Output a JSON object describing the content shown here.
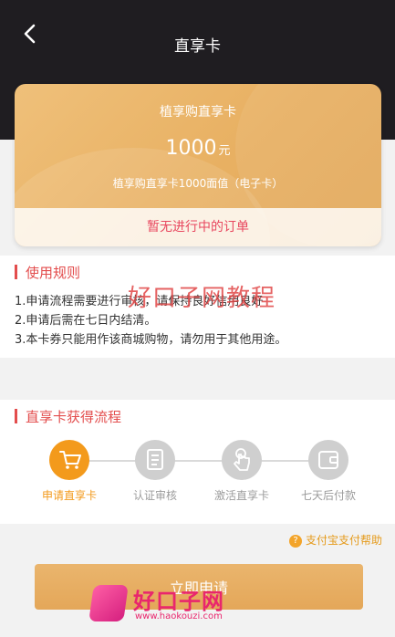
{
  "header": {
    "title": "直享卡"
  },
  "card": {
    "name": "植享购直享卡",
    "amount": "1000",
    "unit": "元",
    "description": "植享购直享卡1000面值（电子卡）",
    "order_status": "暂无进行中的订单"
  },
  "watermark": "好口子网教程",
  "rules": {
    "title": "使用规则",
    "items": [
      "1.申请流程需要进行审核，请保持良好信用良好",
      "2.申请后需在七日内结清。",
      "3.本卡券只能用作该商城购物，请勿用于其他用途。"
    ]
  },
  "flow": {
    "title": "直享卡获得流程",
    "steps": [
      {
        "label": "申请直享卡",
        "icon": "cart-icon",
        "active": true
      },
      {
        "label": "认证审核",
        "icon": "document-icon",
        "active": false
      },
      {
        "label": "激活直享卡",
        "icon": "hand-touch-icon",
        "active": false
      },
      {
        "label": "七天后付款",
        "icon": "wallet-icon",
        "active": false
      }
    ]
  },
  "help": {
    "label": "支付宝支付帮助"
  },
  "apply_button": {
    "label": "立即申请"
  },
  "logo": {
    "brand": "好口子网",
    "url": "www.haokouzi.com"
  },
  "colors": {
    "accent": "#f39a1c",
    "header_bg": "#1f1d21",
    "section_title": "#e34d4d",
    "card": "#e8b062"
  }
}
